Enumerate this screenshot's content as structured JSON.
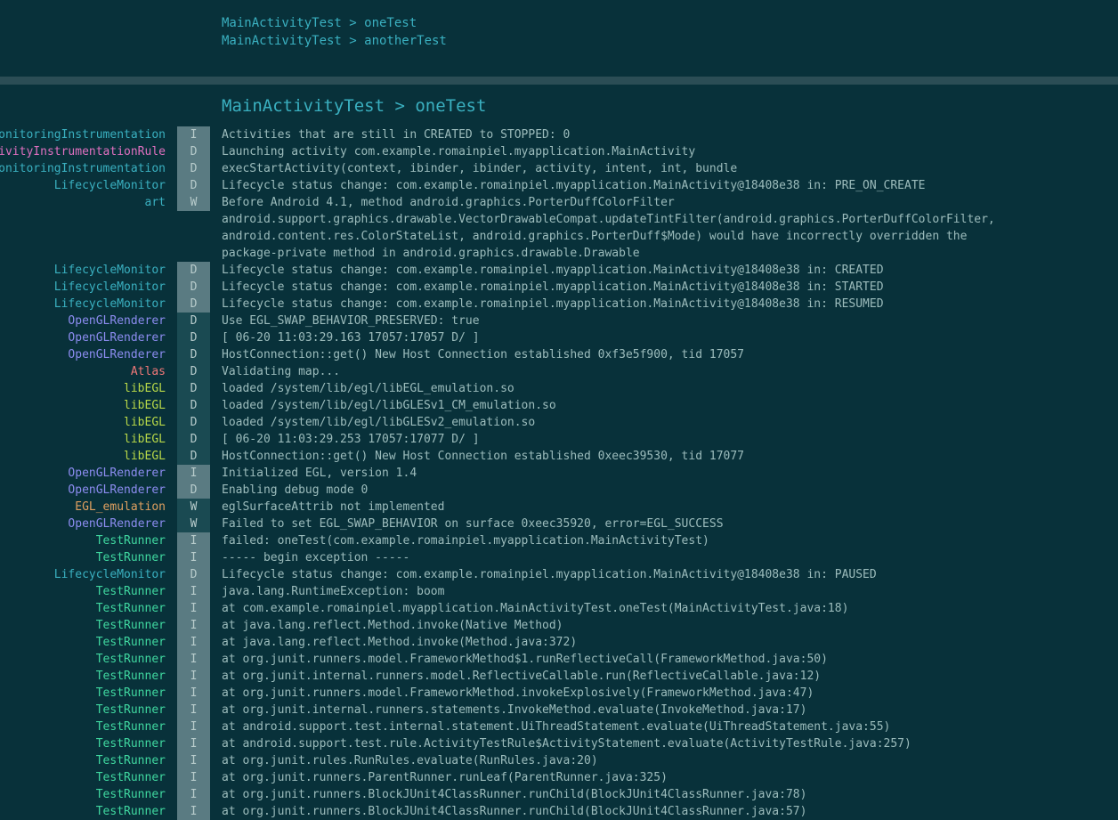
{
  "test_list": [
    "MainActivityTest > oneTest",
    "MainActivityTest > anotherTest"
  ],
  "section_title": "MainActivityTest > oneTest",
  "colors": {
    "background": "#08313a",
    "link": "#3ab0c0",
    "level_gutter": "#1a4a52",
    "level_highlight": "#5a7b82",
    "tag_default": "#3ab0c0",
    "tag_pink": "#e070c0",
    "tag_purple": "#8c8cf0",
    "tag_salmon": "#f07878",
    "tag_green": "#b8d848",
    "tag_orange": "#e0a060",
    "tag_testrunner": "#40d8a0"
  },
  "log_rows": [
    {
      "tag": "MonitoringInstrumentation",
      "level": "I",
      "color": "tag_default",
      "highlight": true,
      "message": "Activities that are still in CREATED to STOPPED: 0"
    },
    {
      "tag": "ActivityInstrumentationRule",
      "level": "D",
      "color": "tag_pink",
      "highlight": true,
      "message": "Launching activity com.example.romainpiel.myapplication.MainActivity"
    },
    {
      "tag": "MonitoringInstrumentation",
      "level": "D",
      "color": "tag_default",
      "highlight": true,
      "message": "execStartActivity(context, ibinder, ibinder, activity, intent, int, bundle"
    },
    {
      "tag": "LifecycleMonitor",
      "level": "D",
      "color": "tag_default",
      "highlight": true,
      "message": "Lifecycle status change: com.example.romainpiel.myapplication.MainActivity@18408e38 in: PRE_ON_CREATE"
    },
    {
      "tag": "art",
      "level": "W",
      "color": "tag_default",
      "highlight": true,
      "message": "Before Android 4.1, method android.graphics.PorterDuffColorFilter\nandroid.support.graphics.drawable.VectorDrawableCompat.updateTintFilter(android.graphics.PorterDuffColorFilter,\nandroid.content.res.ColorStateList, android.graphics.PorterDuff$Mode) would have incorrectly overridden the\npackage-private method in android.graphics.drawable.Drawable"
    },
    {
      "tag": "LifecycleMonitor",
      "level": "D",
      "color": "tag_default",
      "highlight": true,
      "message": "Lifecycle status change: com.example.romainpiel.myapplication.MainActivity@18408e38 in: CREATED"
    },
    {
      "tag": "LifecycleMonitor",
      "level": "D",
      "color": "tag_default",
      "highlight": true,
      "message": "Lifecycle status change: com.example.romainpiel.myapplication.MainActivity@18408e38 in: STARTED"
    },
    {
      "tag": "LifecycleMonitor",
      "level": "D",
      "color": "tag_default",
      "highlight": true,
      "message": "Lifecycle status change: com.example.romainpiel.myapplication.MainActivity@18408e38 in: RESUMED"
    },
    {
      "tag": "OpenGLRenderer",
      "level": "D",
      "color": "tag_purple",
      "highlight": false,
      "message": "Use EGL_SWAP_BEHAVIOR_PRESERVED: true"
    },
    {
      "tag": "OpenGLRenderer",
      "level": "D",
      "color": "tag_purple",
      "highlight": false,
      "message": "[ 06-20 11:03:29.163 17057:17057 D/ ]"
    },
    {
      "tag": "OpenGLRenderer",
      "level": "D",
      "color": "tag_purple",
      "highlight": false,
      "message": "HostConnection::get() New Host Connection established 0xf3e5f900, tid 17057"
    },
    {
      "tag": "Atlas",
      "level": "D",
      "color": "tag_salmon",
      "highlight": false,
      "message": "Validating map..."
    },
    {
      "tag": "libEGL",
      "level": "D",
      "color": "tag_green",
      "highlight": false,
      "message": "loaded /system/lib/egl/libEGL_emulation.so"
    },
    {
      "tag": "libEGL",
      "level": "D",
      "color": "tag_green",
      "highlight": false,
      "message": "loaded /system/lib/egl/libGLESv1_CM_emulation.so"
    },
    {
      "tag": "libEGL",
      "level": "D",
      "color": "tag_green",
      "highlight": false,
      "message": "loaded /system/lib/egl/libGLESv2_emulation.so"
    },
    {
      "tag": "libEGL",
      "level": "D",
      "color": "tag_green",
      "highlight": false,
      "message": "[ 06-20 11:03:29.253 17057:17077 D/ ]"
    },
    {
      "tag": "libEGL",
      "level": "D",
      "color": "tag_green",
      "highlight": false,
      "message": "HostConnection::get() New Host Connection established 0xeec39530, tid 17077"
    },
    {
      "tag": "OpenGLRenderer",
      "level": "I",
      "color": "tag_purple",
      "highlight": true,
      "message": "Initialized EGL, version 1.4"
    },
    {
      "tag": "OpenGLRenderer",
      "level": "D",
      "color": "tag_purple",
      "highlight": true,
      "message": "Enabling debug mode 0"
    },
    {
      "tag": "EGL_emulation",
      "level": "W",
      "color": "tag_orange",
      "highlight": false,
      "message": "eglSurfaceAttrib not implemented"
    },
    {
      "tag": "OpenGLRenderer",
      "level": "W",
      "color": "tag_purple",
      "highlight": false,
      "message": "Failed to set EGL_SWAP_BEHAVIOR on surface 0xeec35920, error=EGL_SUCCESS"
    },
    {
      "tag": "TestRunner",
      "level": "I",
      "color": "tag_testrunner",
      "highlight": true,
      "message": "failed: oneTest(com.example.romainpiel.myapplication.MainActivityTest)"
    },
    {
      "tag": "TestRunner",
      "level": "I",
      "color": "tag_testrunner",
      "highlight": true,
      "message": "----- begin exception -----"
    },
    {
      "tag": "LifecycleMonitor",
      "level": "D",
      "color": "tag_default",
      "highlight": true,
      "message": "Lifecycle status change: com.example.romainpiel.myapplication.MainActivity@18408e38 in: PAUSED"
    },
    {
      "tag": "TestRunner",
      "level": "I",
      "color": "tag_testrunner",
      "highlight": true,
      "message": "java.lang.RuntimeException: boom"
    },
    {
      "tag": "TestRunner",
      "level": "I",
      "color": "tag_testrunner",
      "highlight": true,
      "message": "at com.example.romainpiel.myapplication.MainActivityTest.oneTest(MainActivityTest.java:18)"
    },
    {
      "tag": "TestRunner",
      "level": "I",
      "color": "tag_testrunner",
      "highlight": true,
      "message": "at java.lang.reflect.Method.invoke(Native Method)"
    },
    {
      "tag": "TestRunner",
      "level": "I",
      "color": "tag_testrunner",
      "highlight": true,
      "message": "at java.lang.reflect.Method.invoke(Method.java:372)"
    },
    {
      "tag": "TestRunner",
      "level": "I",
      "color": "tag_testrunner",
      "highlight": true,
      "message": "at org.junit.runners.model.FrameworkMethod$1.runReflectiveCall(FrameworkMethod.java:50)"
    },
    {
      "tag": "TestRunner",
      "level": "I",
      "color": "tag_testrunner",
      "highlight": true,
      "message": "at org.junit.internal.runners.model.ReflectiveCallable.run(ReflectiveCallable.java:12)"
    },
    {
      "tag": "TestRunner",
      "level": "I",
      "color": "tag_testrunner",
      "highlight": true,
      "message": "at org.junit.runners.model.FrameworkMethod.invokeExplosively(FrameworkMethod.java:47)"
    },
    {
      "tag": "TestRunner",
      "level": "I",
      "color": "tag_testrunner",
      "highlight": true,
      "message": "at org.junit.internal.runners.statements.InvokeMethod.evaluate(InvokeMethod.java:17)"
    },
    {
      "tag": "TestRunner",
      "level": "I",
      "color": "tag_testrunner",
      "highlight": true,
      "message": "at android.support.test.internal.statement.UiThreadStatement.evaluate(UiThreadStatement.java:55)"
    },
    {
      "tag": "TestRunner",
      "level": "I",
      "color": "tag_testrunner",
      "highlight": true,
      "message": "at android.support.test.rule.ActivityTestRule$ActivityStatement.evaluate(ActivityTestRule.java:257)"
    },
    {
      "tag": "TestRunner",
      "level": "I",
      "color": "tag_testrunner",
      "highlight": true,
      "message": "at org.junit.rules.RunRules.evaluate(RunRules.java:20)"
    },
    {
      "tag": "TestRunner",
      "level": "I",
      "color": "tag_testrunner",
      "highlight": true,
      "message": "at org.junit.runners.ParentRunner.runLeaf(ParentRunner.java:325)"
    },
    {
      "tag": "TestRunner",
      "level": "I",
      "color": "tag_testrunner",
      "highlight": true,
      "message": "at org.junit.runners.BlockJUnit4ClassRunner.runChild(BlockJUnit4ClassRunner.java:78)"
    },
    {
      "tag": "TestRunner",
      "level": "I",
      "color": "tag_testrunner",
      "highlight": true,
      "message": "at org.junit.runners.BlockJUnit4ClassRunner.runChild(BlockJUnit4ClassRunner.java:57)"
    }
  ]
}
